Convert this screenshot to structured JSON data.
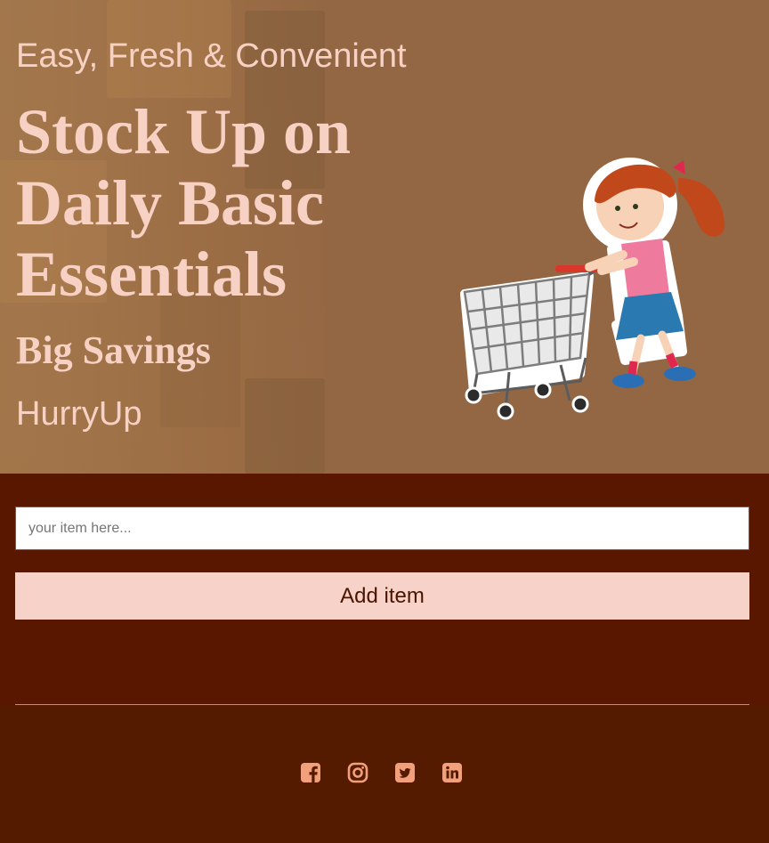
{
  "hero": {
    "tagline": "Easy, Fresh & Convenient",
    "headline": "Stock Up on Daily Basic Essentials",
    "subhead": "Big Savings",
    "cta_text": "HurryUp"
  },
  "form": {
    "input_placeholder": "your item here...",
    "input_value": "",
    "add_button_label": "Add item"
  },
  "footer": {
    "social_icons": [
      "facebook-icon",
      "instagram-icon",
      "twitter-icon",
      "linkedin-icon"
    ]
  },
  "colors": {
    "hero_bg": "#946744",
    "hero_text": "#f7d2c4",
    "form_bg": "#591700",
    "button_bg": "#f7d2c8",
    "button_text": "#4a1400",
    "footer_bg": "#541b00",
    "icon_color": "#f2a07b"
  }
}
